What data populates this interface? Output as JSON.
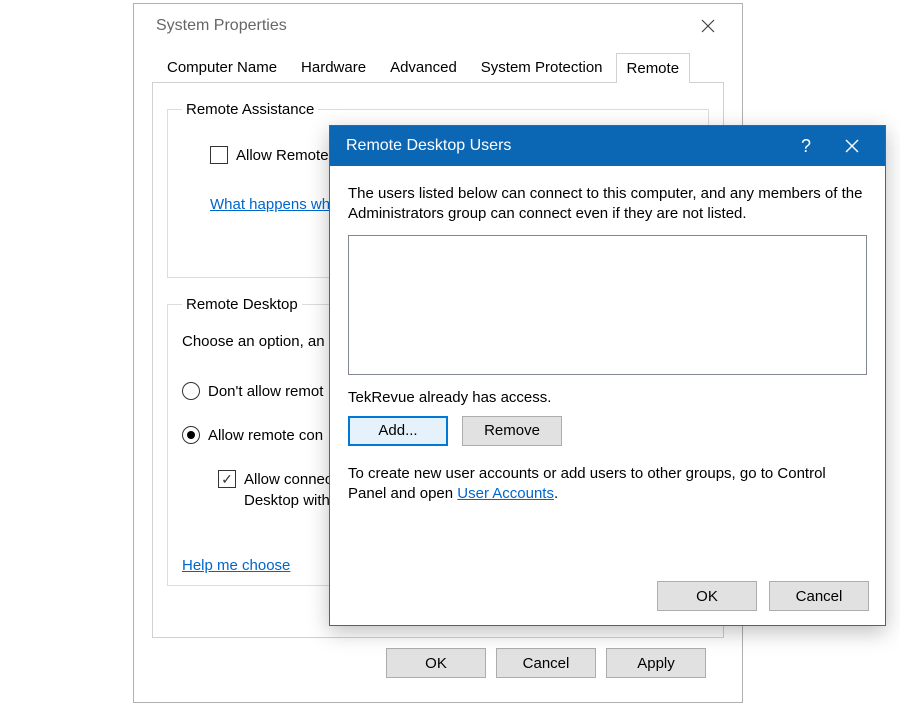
{
  "sysprops": {
    "title": "System Properties",
    "tabs": [
      "Computer Name",
      "Hardware",
      "Advanced",
      "System Protection",
      "Remote"
    ],
    "active_tab_index": 4,
    "remote_assistance": {
      "legend": "Remote Assistance",
      "allow_label": "Allow Remote Assistance connections to this computer",
      "allow_label_truncated": "Allow Remote As",
      "help_link": "What happens when",
      "allow_checked": false
    },
    "remote_desktop": {
      "legend": "Remote Desktop",
      "choose_label": "Choose an option, an",
      "opt_disallow": "Don't allow remot",
      "opt_allow": "Allow remote con",
      "nla_label_line1": "Allow connect",
      "nla_label_line2": "Desktop with",
      "nla_checked": true,
      "selected": "allow",
      "help_link": "Help me choose"
    },
    "buttons": {
      "ok": "OK",
      "cancel": "Cancel",
      "apply": "Apply"
    }
  },
  "rdu": {
    "title": "Remote Desktop Users",
    "desc": "The users listed below can connect to this computer, and any members of the Administrators group can connect even if they are not listed.",
    "users": [],
    "access_note": "TekRevue already has access.",
    "add": "Add...",
    "remove": "Remove",
    "hint_before": "To create new user accounts or add users to other groups, go to Control Panel and open ",
    "hint_link": "User Accounts",
    "hint_after": ".",
    "ok": "OK",
    "cancel": "Cancel",
    "help_glyph": "?"
  }
}
